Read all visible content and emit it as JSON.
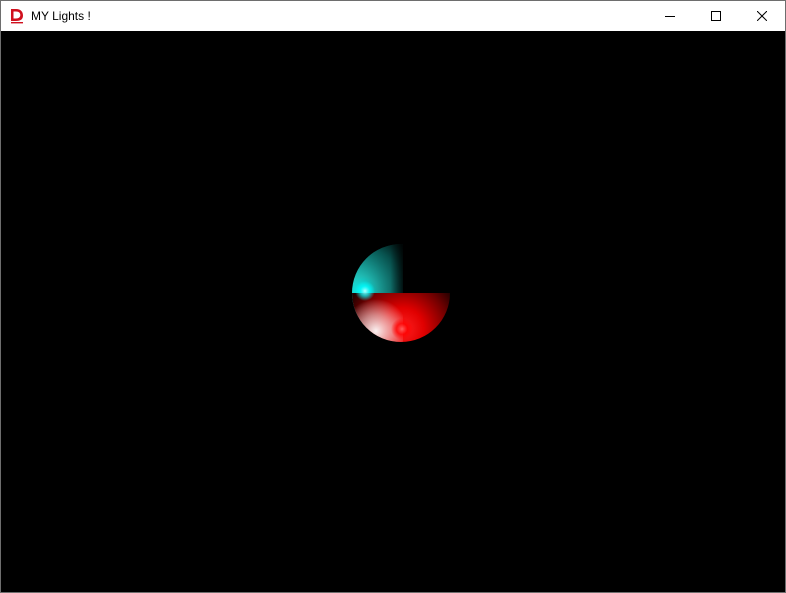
{
  "window": {
    "title": "MY Lights !",
    "app_icon": "d-logo-icon",
    "controls": {
      "minimize": "minimize-icon",
      "maximize": "maximize-icon",
      "close": "close-icon"
    }
  },
  "scene": {
    "background_color": "#000000",
    "object": "lit-sphere",
    "lights": [
      {
        "color": "#00ffff",
        "icon": "cyan-light"
      },
      {
        "color": "#ff0000",
        "icon": "red-light"
      }
    ]
  }
}
